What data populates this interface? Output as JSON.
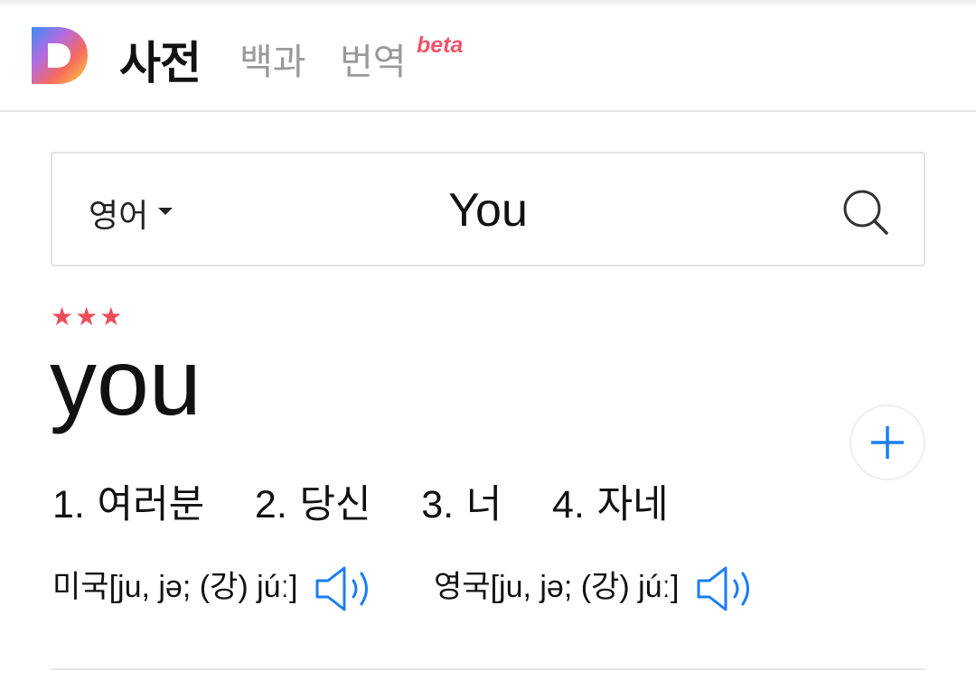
{
  "header": {
    "logo_letter": "D",
    "current_section": "사전",
    "links": [
      "백과",
      "번역"
    ],
    "beta_label": "beta"
  },
  "search": {
    "language": "영어",
    "query": "You"
  },
  "entry": {
    "stars": "★★★",
    "headword": "you",
    "meanings": [
      {
        "num": "1.",
        "text": "여러분"
      },
      {
        "num": "2.",
        "text": "당신"
      },
      {
        "num": "3.",
        "text": "너"
      },
      {
        "num": "4.",
        "text": "자네"
      }
    ],
    "pronunciations": [
      {
        "region": "미국",
        "ipa": "[ju, jə; (강) júː]"
      },
      {
        "region": "영국",
        "ipa": "[ju, jə; (강) júː]"
      }
    ]
  },
  "colors": {
    "accent_blue": "#1a7ef3",
    "star_red": "#ef4c58",
    "beta_pink": "#f0546a"
  },
  "icons": {
    "search": "search-icon",
    "add": "plus-icon",
    "speaker": "speaker-icon",
    "caret": "caret-down-icon"
  }
}
